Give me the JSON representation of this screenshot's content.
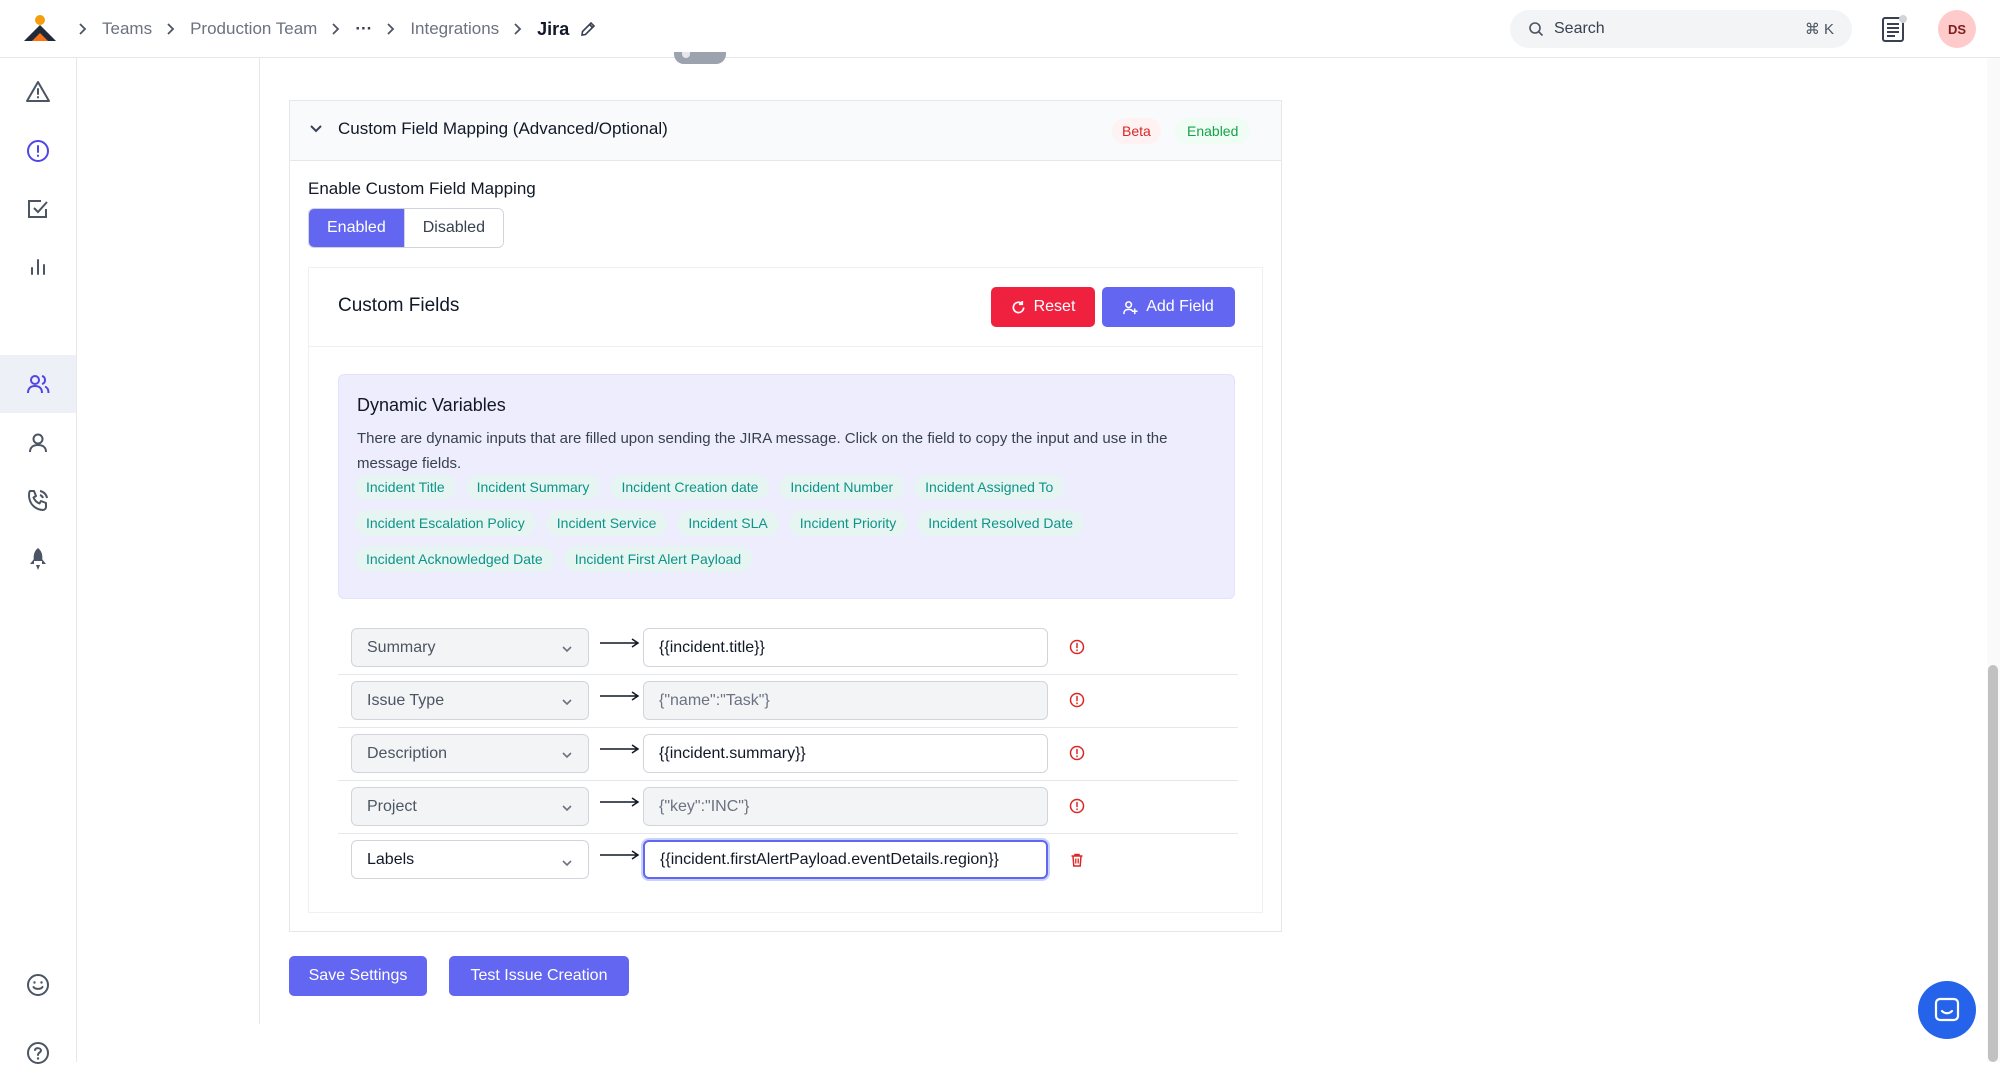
{
  "breadcrumb": {
    "items": [
      "Teams",
      "Production Team",
      "···",
      "Integrations"
    ],
    "current": "Jira"
  },
  "search": {
    "placeholder": "Search",
    "shortcut": "⌘ K"
  },
  "user": {
    "initials": "DS"
  },
  "panel": {
    "title": "Custom Field Mapping (Advanced/Optional)",
    "badges": {
      "beta": "Beta",
      "enabled": "Enabled"
    },
    "enable_label": "Enable Custom Field Mapping",
    "segments": {
      "enabled": "Enabled",
      "disabled": "Disabled"
    }
  },
  "custom_fields": {
    "title": "Custom Fields",
    "reset_label": "Reset",
    "add_label": "Add Field"
  },
  "dynamic_variables": {
    "title": "Dynamic Variables",
    "description": "There are dynamic inputs that are filled upon sending the JIRA message. Click on the field to copy the input and use in the message fields.",
    "chips": [
      "Incident Title",
      "Incident Summary",
      "Incident Creation date",
      "Incident Number",
      "Incident Assigned To",
      "Incident Escalation Policy",
      "Incident Service",
      "Incident SLA",
      "Incident Priority",
      "Incident Resolved Date",
      "Incident Acknowledged Date",
      "Incident First Alert Payload"
    ]
  },
  "mappings": [
    {
      "field": "Summary",
      "value": "{{incident.title}}"
    },
    {
      "field": "Issue Type",
      "value": "{\"name\":\"Task\"}"
    },
    {
      "field": "Description",
      "value": "{{incident.summary}}"
    },
    {
      "field": "Project",
      "value": "{\"key\":\"INC\"}"
    },
    {
      "field": "Labels",
      "value": "{{incident.firstAlertPayload.eventDetails.region}}"
    }
  ],
  "actions": {
    "save": "Save Settings",
    "test": "Test Issue Creation"
  },
  "colors": {
    "accent": "#6366f1",
    "danger": "#f0213f",
    "chip_text": "#0d9488",
    "dyn_bg": "#eeedfd"
  },
  "icons": [
    "warning-icon",
    "alert-circle-icon",
    "check-square-icon",
    "bar-chart-icon",
    "users-icon",
    "user-icon",
    "phone-call-icon",
    "rocket-icon",
    "smile-icon",
    "help-circle-icon"
  ]
}
